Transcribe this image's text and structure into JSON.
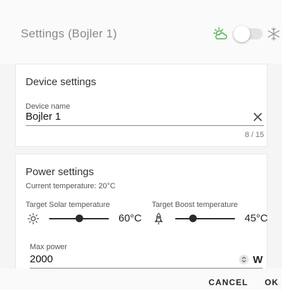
{
  "dialog": {
    "title": "Settings (Bojler 1)",
    "mode_toggle": {
      "checked": false
    },
    "icons": {
      "left": "sun-behind-cloud-icon",
      "right": "snowflake-icon"
    },
    "accent_color": "#4caf50"
  },
  "device_settings": {
    "title": "Device settings",
    "name_field": {
      "label": "Device name",
      "value": "Bojler 1",
      "counter": "8 / 15"
    }
  },
  "power_settings": {
    "title": "Power settings",
    "current_temperature": "Current temperature: 20°C",
    "solar": {
      "label": "Target Solar temperature",
      "value_text": "60°C",
      "level": 0.5,
      "icon": "sun-icon"
    },
    "boost": {
      "label": "Target Boost temperature",
      "value_text": "45°C",
      "level": 0.3,
      "icon": "rocket-icon"
    },
    "max_power": {
      "label": "Max power",
      "value": "2000",
      "unit": "W"
    }
  },
  "actions": {
    "cancel": "CANCEL",
    "ok": "OK"
  }
}
